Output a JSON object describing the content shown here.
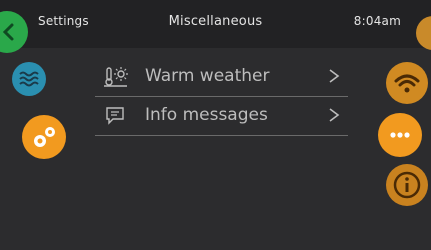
{
  "header": {
    "back_label": "Settings",
    "title": "Miscellaneous",
    "time": "8:04am"
  },
  "menu": {
    "items": [
      {
        "label": "Warm weather",
        "icon": "thermometer-sun-icon"
      },
      {
        "label": "Info messages",
        "icon": "message-icon"
      }
    ]
  },
  "left_nav": [
    {
      "icon": "back-arrow-icon",
      "color": "#2aa84a"
    },
    {
      "icon": "water-waves-icon",
      "color": "#2a8fb0"
    },
    {
      "icon": "gears-icon",
      "color": "#f29a1f"
    }
  ],
  "right_nav": [
    {
      "icon": "orange-circle-top",
      "color": "#c98a2a"
    },
    {
      "icon": "wifi-icon",
      "color": "#d08a22"
    },
    {
      "icon": "more-dots-icon",
      "color": "#f29a1f"
    },
    {
      "icon": "info-icon",
      "color": "#c9821f"
    }
  ],
  "colors": {
    "background": "#2c2c2e",
    "topbar": "#222224",
    "text": "#bdbdbd",
    "divider": "#6a6a6a"
  }
}
